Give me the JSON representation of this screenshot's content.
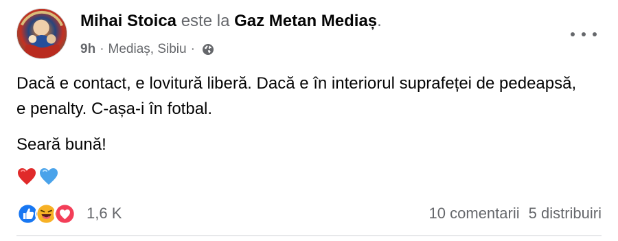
{
  "post": {
    "author": {
      "name": "Mihai Stoica",
      "activity_text": "este la",
      "page": "Gaz Metan Mediaș",
      "suffix": "."
    },
    "meta": {
      "time": "9h",
      "separator": "·",
      "location": "Mediaș, Sibiu",
      "privacy_icon": "globe-icon"
    },
    "body": {
      "paragraph_1": "Dacă e contact, e lovitură liberă. Dacă e în interiorul suprafeței de pedeapsă, e penalty. C-așa-i în fotbal.",
      "paragraph_2": "Seară bună!"
    },
    "body_emojis": [
      "red-heart-icon",
      "blue-heart-icon"
    ],
    "stats": {
      "reaction_icons": [
        "like-icon",
        "haha-icon",
        "love-icon"
      ],
      "reaction_count": "1,6 K",
      "comments": "10 comentarii",
      "shares": "5 distribuiri"
    },
    "colors": {
      "secondary_text": "#65676b",
      "primary_text": "#050505",
      "like_blue": "#1877f2",
      "love_red": "#f33e58",
      "haha_yellow": "#f7b125",
      "divider": "#ced0d4"
    }
  }
}
